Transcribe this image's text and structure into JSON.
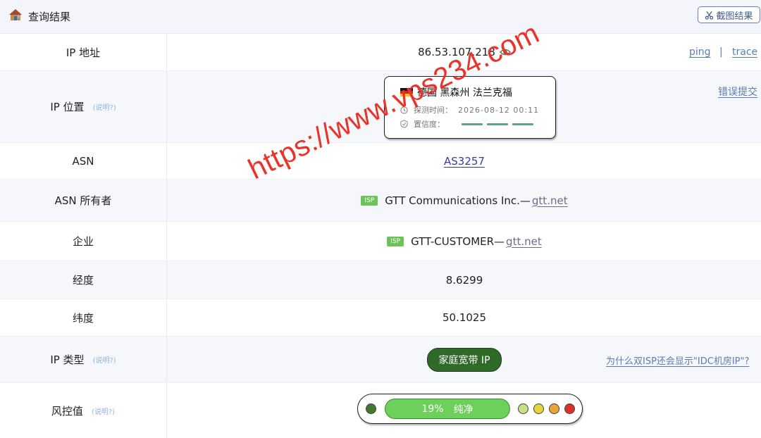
{
  "header": {
    "title": "查询结果",
    "screenshot_button": "截图结果"
  },
  "rows": {
    "ip": {
      "label": "IP 地址",
      "value": "86.53.107.218",
      "ping": "ping",
      "separator": "|",
      "trace": "trace"
    },
    "location": {
      "label": "IP 位置",
      "hint": "(说明?)",
      "place": "德国 黑森州 法兰克福",
      "detect_label": "探测时间：",
      "detect_time": "2026-08-12 00:11",
      "confidence_label": "置信度：",
      "report": "错误提交"
    },
    "asn": {
      "label": "ASN",
      "value": "AS3257"
    },
    "asn_owner": {
      "label": "ASN 所有者",
      "badge": "ISP",
      "name": "GTT Communications Inc.—",
      "domain": "gtt.net"
    },
    "company": {
      "label": "企业",
      "badge": "ISP",
      "name": "GTT-CUSTOMER—",
      "domain": "gtt.net"
    },
    "longitude": {
      "label": "经度",
      "value": "8.6299"
    },
    "latitude": {
      "label": "纬度",
      "value": "50.1025"
    },
    "ip_type": {
      "label": "IP 类型",
      "hint": "(说明?)",
      "value": "家庭宽带 IP",
      "note": "为什么双ISP还会显示\"IDC机房IP\"?"
    },
    "risk": {
      "label": "风控值",
      "hint": "(说明?)",
      "score": "19%",
      "level": "纯净",
      "score_fraction": 0.19
    }
  },
  "watermark": "https://www.vps234.com",
  "colors": {
    "accent": "#5a7db5",
    "isp_badge": "#6dc25a",
    "home_pill": "#2f6a28",
    "risk_green": "#6dd05a",
    "watermark": "#e8342a"
  }
}
